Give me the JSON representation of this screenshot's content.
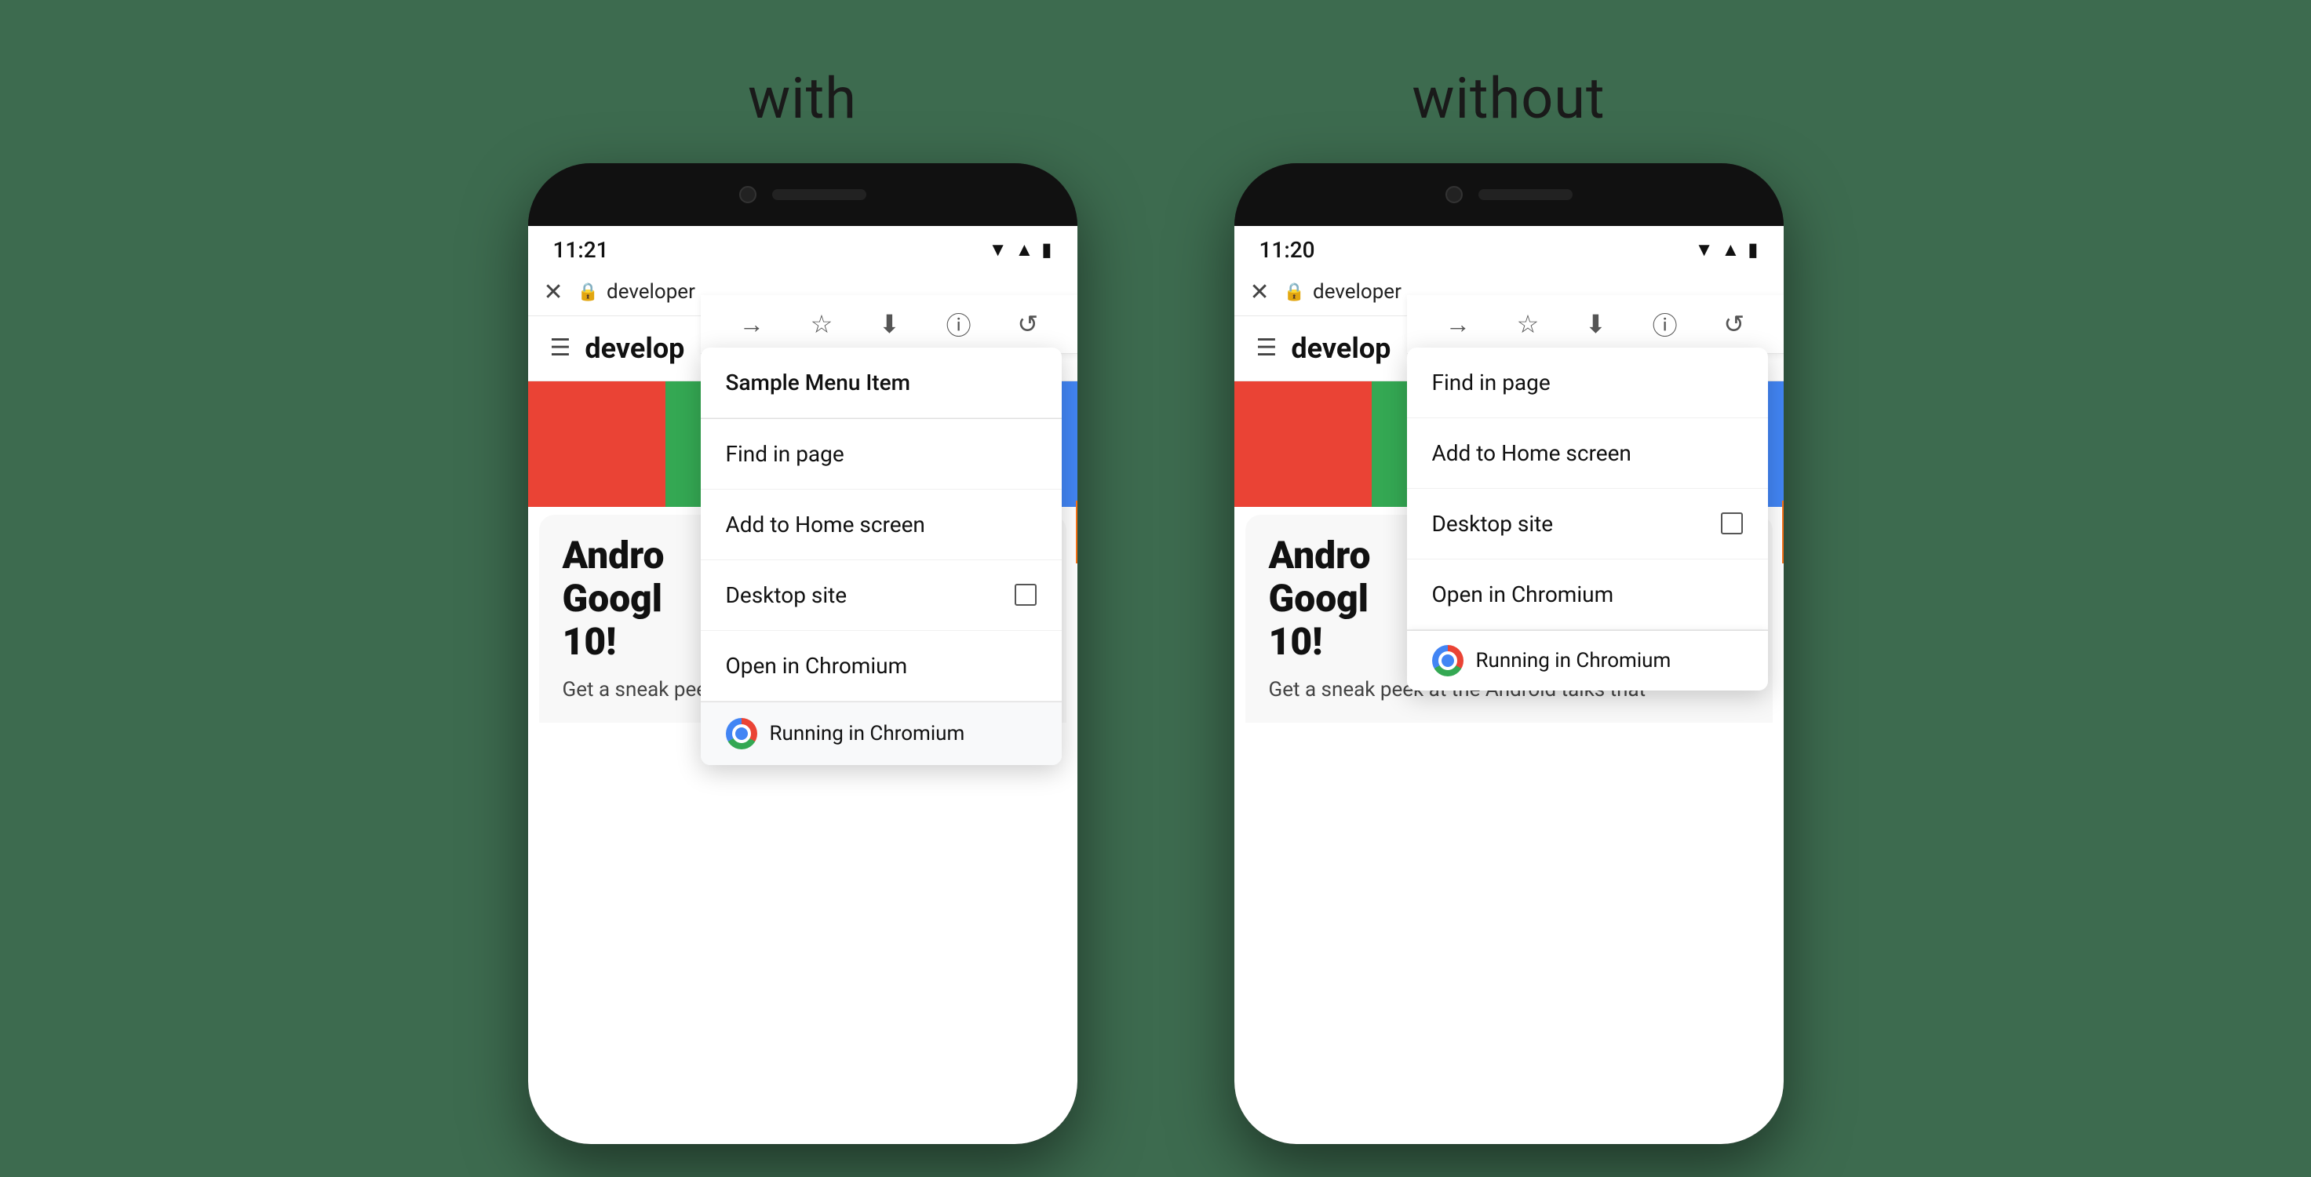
{
  "background_color": "#3d6b4f",
  "panels": {
    "with": {
      "label": "with",
      "time": "11:21",
      "url": "developer",
      "page_title": "develop",
      "article_headline": "Andro\nGoogl\n10!",
      "article_sub": "Get a sneak peek at the Android talks that",
      "menu": {
        "toolbar_icons": [
          "→",
          "☆",
          "⬇",
          "ⓘ",
          "↺"
        ],
        "items": [
          {
            "label": "Sample Menu Item",
            "has_checkbox": false,
            "is_sample": true
          },
          {
            "label": "Find in page",
            "has_checkbox": false
          },
          {
            "label": "Add to Home screen",
            "has_checkbox": false
          },
          {
            "label": "Desktop site",
            "has_checkbox": true
          },
          {
            "label": "Open in Chromium",
            "has_checkbox": false
          }
        ],
        "running_label": "Running in Chromium"
      }
    },
    "without": {
      "label": "without",
      "time": "11:20",
      "url": "developer",
      "page_title": "develop",
      "article_headline": "Andro\nGoogl\n10!",
      "article_sub": "Get a sneak peek at the Android talks that",
      "menu": {
        "toolbar_icons": [
          "→",
          "☆",
          "⬇",
          "ⓘ",
          "↺"
        ],
        "items": [
          {
            "label": "Find in page",
            "has_checkbox": false
          },
          {
            "label": "Add to Home screen",
            "has_checkbox": false
          },
          {
            "label": "Desktop site",
            "has_checkbox": true
          },
          {
            "label": "Open in Chromium",
            "has_checkbox": false
          }
        ],
        "running_label": "Running in Chromium"
      }
    }
  },
  "color_bars": [
    "#ea4335",
    "#34a853",
    "#fbbc04",
    "#4285f4"
  ],
  "icons": {
    "close": "✕",
    "lock": "🔒",
    "hamburger": "☰",
    "arrow_forward": "→",
    "star": "☆",
    "download": "⬇",
    "info": "ⓘ",
    "refresh": "↺",
    "wifi": "▲",
    "signal": "▲",
    "battery": "▮"
  }
}
